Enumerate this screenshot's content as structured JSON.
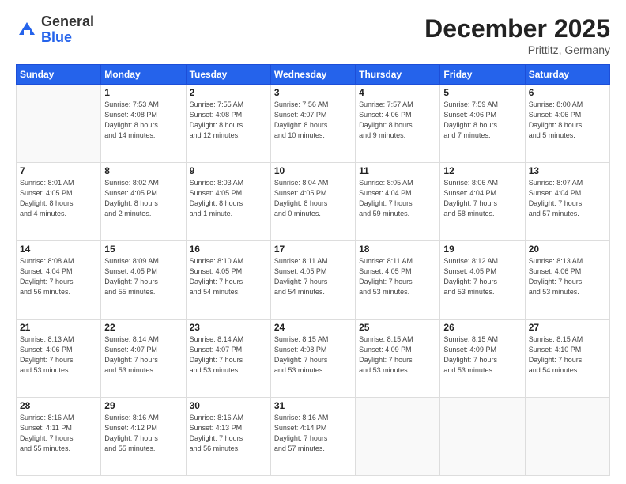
{
  "header": {
    "logo_general": "General",
    "logo_blue": "Blue",
    "month_title": "December 2025",
    "subtitle": "Prittitz, Germany"
  },
  "weekdays": [
    "Sunday",
    "Monday",
    "Tuesday",
    "Wednesday",
    "Thursday",
    "Friday",
    "Saturday"
  ],
  "weeks": [
    [
      {
        "day": "",
        "info": ""
      },
      {
        "day": "1",
        "info": "Sunrise: 7:53 AM\nSunset: 4:08 PM\nDaylight: 8 hours\nand 14 minutes."
      },
      {
        "day": "2",
        "info": "Sunrise: 7:55 AM\nSunset: 4:08 PM\nDaylight: 8 hours\nand 12 minutes."
      },
      {
        "day": "3",
        "info": "Sunrise: 7:56 AM\nSunset: 4:07 PM\nDaylight: 8 hours\nand 10 minutes."
      },
      {
        "day": "4",
        "info": "Sunrise: 7:57 AM\nSunset: 4:06 PM\nDaylight: 8 hours\nand 9 minutes."
      },
      {
        "day": "5",
        "info": "Sunrise: 7:59 AM\nSunset: 4:06 PM\nDaylight: 8 hours\nand 7 minutes."
      },
      {
        "day": "6",
        "info": "Sunrise: 8:00 AM\nSunset: 4:06 PM\nDaylight: 8 hours\nand 5 minutes."
      }
    ],
    [
      {
        "day": "7",
        "info": "Sunrise: 8:01 AM\nSunset: 4:05 PM\nDaylight: 8 hours\nand 4 minutes."
      },
      {
        "day": "8",
        "info": "Sunrise: 8:02 AM\nSunset: 4:05 PM\nDaylight: 8 hours\nand 2 minutes."
      },
      {
        "day": "9",
        "info": "Sunrise: 8:03 AM\nSunset: 4:05 PM\nDaylight: 8 hours\nand 1 minute."
      },
      {
        "day": "10",
        "info": "Sunrise: 8:04 AM\nSunset: 4:05 PM\nDaylight: 8 hours\nand 0 minutes."
      },
      {
        "day": "11",
        "info": "Sunrise: 8:05 AM\nSunset: 4:04 PM\nDaylight: 7 hours\nand 59 minutes."
      },
      {
        "day": "12",
        "info": "Sunrise: 8:06 AM\nSunset: 4:04 PM\nDaylight: 7 hours\nand 58 minutes."
      },
      {
        "day": "13",
        "info": "Sunrise: 8:07 AM\nSunset: 4:04 PM\nDaylight: 7 hours\nand 57 minutes."
      }
    ],
    [
      {
        "day": "14",
        "info": "Sunrise: 8:08 AM\nSunset: 4:04 PM\nDaylight: 7 hours\nand 56 minutes."
      },
      {
        "day": "15",
        "info": "Sunrise: 8:09 AM\nSunset: 4:05 PM\nDaylight: 7 hours\nand 55 minutes."
      },
      {
        "day": "16",
        "info": "Sunrise: 8:10 AM\nSunset: 4:05 PM\nDaylight: 7 hours\nand 54 minutes."
      },
      {
        "day": "17",
        "info": "Sunrise: 8:11 AM\nSunset: 4:05 PM\nDaylight: 7 hours\nand 54 minutes."
      },
      {
        "day": "18",
        "info": "Sunrise: 8:11 AM\nSunset: 4:05 PM\nDaylight: 7 hours\nand 53 minutes."
      },
      {
        "day": "19",
        "info": "Sunrise: 8:12 AM\nSunset: 4:05 PM\nDaylight: 7 hours\nand 53 minutes."
      },
      {
        "day": "20",
        "info": "Sunrise: 8:13 AM\nSunset: 4:06 PM\nDaylight: 7 hours\nand 53 minutes."
      }
    ],
    [
      {
        "day": "21",
        "info": "Sunrise: 8:13 AM\nSunset: 4:06 PM\nDaylight: 7 hours\nand 53 minutes."
      },
      {
        "day": "22",
        "info": "Sunrise: 8:14 AM\nSunset: 4:07 PM\nDaylight: 7 hours\nand 53 minutes."
      },
      {
        "day": "23",
        "info": "Sunrise: 8:14 AM\nSunset: 4:07 PM\nDaylight: 7 hours\nand 53 minutes."
      },
      {
        "day": "24",
        "info": "Sunrise: 8:15 AM\nSunset: 4:08 PM\nDaylight: 7 hours\nand 53 minutes."
      },
      {
        "day": "25",
        "info": "Sunrise: 8:15 AM\nSunset: 4:09 PM\nDaylight: 7 hours\nand 53 minutes."
      },
      {
        "day": "26",
        "info": "Sunrise: 8:15 AM\nSunset: 4:09 PM\nDaylight: 7 hours\nand 53 minutes."
      },
      {
        "day": "27",
        "info": "Sunrise: 8:15 AM\nSunset: 4:10 PM\nDaylight: 7 hours\nand 54 minutes."
      }
    ],
    [
      {
        "day": "28",
        "info": "Sunrise: 8:16 AM\nSunset: 4:11 PM\nDaylight: 7 hours\nand 55 minutes."
      },
      {
        "day": "29",
        "info": "Sunrise: 8:16 AM\nSunset: 4:12 PM\nDaylight: 7 hours\nand 55 minutes."
      },
      {
        "day": "30",
        "info": "Sunrise: 8:16 AM\nSunset: 4:13 PM\nDaylight: 7 hours\nand 56 minutes."
      },
      {
        "day": "31",
        "info": "Sunrise: 8:16 AM\nSunset: 4:14 PM\nDaylight: 7 hours\nand 57 minutes."
      },
      {
        "day": "",
        "info": ""
      },
      {
        "day": "",
        "info": ""
      },
      {
        "day": "",
        "info": ""
      }
    ]
  ]
}
